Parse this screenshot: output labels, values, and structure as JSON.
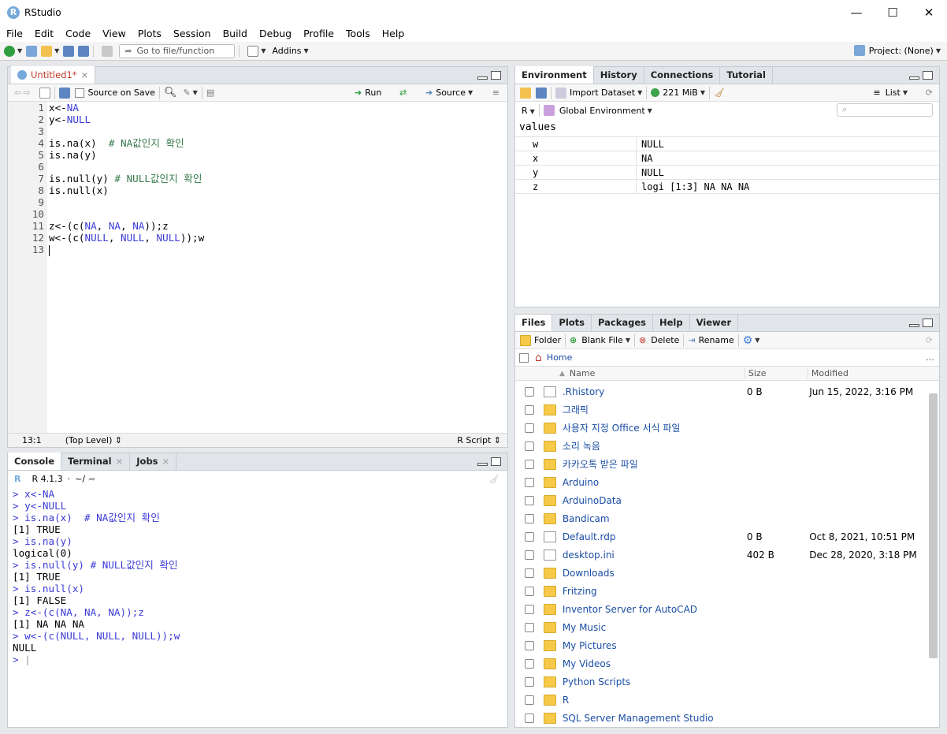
{
  "app": {
    "title": "RStudio",
    "logo": "R"
  },
  "window_controls": {
    "minimize": "—",
    "maximize": "☐",
    "close": "✕"
  },
  "menu": [
    "File",
    "Edit",
    "Code",
    "View",
    "Plots",
    "Session",
    "Build",
    "Debug",
    "Profile",
    "Tools",
    "Help"
  ],
  "toolbar": {
    "goto_placeholder": "Go to file/function",
    "addins": "Addins",
    "project": "Project: (None)"
  },
  "editor": {
    "tab_label": "Untitled1*",
    "source_on_save": "Source on Save",
    "run": "Run",
    "source": "Source",
    "cursor_pos": "13:1",
    "scope": "(Top Level)",
    "file_type": "R Script",
    "lines": [
      {
        "n": "1",
        "parts": [
          [
            "x<-",
            ""
          ],
          [
            "NA",
            "kw"
          ]
        ]
      },
      {
        "n": "2",
        "parts": [
          [
            "y<-",
            ""
          ],
          [
            "NULL",
            "kw"
          ]
        ]
      },
      {
        "n": "3",
        "parts": []
      },
      {
        "n": "4",
        "parts": [
          [
            "is.na(x)  ",
            ""
          ],
          [
            "# NA값인지 확인",
            "cm"
          ]
        ]
      },
      {
        "n": "5",
        "parts": [
          [
            "is.na(y)",
            ""
          ]
        ]
      },
      {
        "n": "6",
        "parts": []
      },
      {
        "n": "7",
        "parts": [
          [
            "is.null(y) ",
            ""
          ],
          [
            "# NULL값인지 확인",
            "cm"
          ]
        ]
      },
      {
        "n": "8",
        "parts": [
          [
            "is.null(x)",
            ""
          ]
        ]
      },
      {
        "n": "9",
        "parts": []
      },
      {
        "n": "10",
        "parts": []
      },
      {
        "n": "11",
        "parts": [
          [
            "z<-(c(",
            ""
          ],
          [
            "NA",
            "kw"
          ],
          [
            ", ",
            ""
          ],
          [
            "NA",
            "kw"
          ],
          [
            ", ",
            ""
          ],
          [
            "NA",
            "kw"
          ],
          [
            "));z",
            ""
          ]
        ]
      },
      {
        "n": "12",
        "parts": [
          [
            "w<-(c(",
            ""
          ],
          [
            "NULL",
            "kw"
          ],
          [
            ", ",
            ""
          ],
          [
            "NULL",
            "kw"
          ],
          [
            ", ",
            ""
          ],
          [
            "NULL",
            "kw"
          ],
          [
            "));w",
            ""
          ]
        ]
      },
      {
        "n": "13",
        "parts": []
      }
    ]
  },
  "console": {
    "tabs": [
      "Console",
      "Terminal",
      "Jobs"
    ],
    "version": "R 4.1.3",
    "path": "~/",
    "lines": [
      {
        "t": "> ",
        "c": "x<-NA",
        "in": true
      },
      {
        "t": "> ",
        "c": "y<-NULL",
        "in": true
      },
      {
        "t": "> ",
        "c": "is.na(x)  # NA값인지 확인",
        "in": true
      },
      {
        "t": "",
        "c": "[1] TRUE",
        "in": false
      },
      {
        "t": "> ",
        "c": "is.na(y)",
        "in": true
      },
      {
        "t": "",
        "c": "logical(0)",
        "in": false
      },
      {
        "t": "> ",
        "c": "is.null(y) # NULL값인지 확인",
        "in": true
      },
      {
        "t": "",
        "c": "[1] TRUE",
        "in": false
      },
      {
        "t": "> ",
        "c": "is.null(x)",
        "in": true
      },
      {
        "t": "",
        "c": "[1] FALSE",
        "in": false
      },
      {
        "t": "> ",
        "c": "z<-(c(NA, NA, NA));z",
        "in": true
      },
      {
        "t": "",
        "c": "[1] NA NA NA",
        "in": false
      },
      {
        "t": "> ",
        "c": "w<-(c(NULL, NULL, NULL));w",
        "in": true
      },
      {
        "t": "",
        "c": "NULL",
        "in": false
      },
      {
        "t": "> ",
        "c": "|",
        "in": true
      }
    ]
  },
  "environment": {
    "tabs": [
      "Environment",
      "History",
      "Connections",
      "Tutorial"
    ],
    "import_dataset": "Import Dataset",
    "memory": "221 MiB",
    "view": "List",
    "lang": "R",
    "scope": "Global Environment",
    "section": "values",
    "rows": [
      {
        "name": "w",
        "value": "NULL"
      },
      {
        "name": "x",
        "value": "NA"
      },
      {
        "name": "y",
        "value": "NULL"
      },
      {
        "name": "z",
        "value": "logi [1:3] NA NA NA"
      }
    ]
  },
  "files": {
    "tabs": [
      "Files",
      "Plots",
      "Packages",
      "Help",
      "Viewer"
    ],
    "folder": "Folder",
    "blank_file": "Blank File",
    "delete": "Delete",
    "rename": "Rename",
    "home": "Home",
    "col_name": "Name",
    "col_size": "Size",
    "col_modified": "Modified",
    "items": [
      {
        "name": ".Rhistory",
        "size": "0 B",
        "modified": "Jun 15, 2022, 3:16 PM",
        "kind": "doc"
      },
      {
        "name": "그래픽",
        "size": "",
        "modified": "",
        "kind": "folder"
      },
      {
        "name": "사용자 지정 Office 서식 파일",
        "size": "",
        "modified": "",
        "kind": "folder"
      },
      {
        "name": "소리 녹음",
        "size": "",
        "modified": "",
        "kind": "folder"
      },
      {
        "name": "카카오톡 받은 파일",
        "size": "",
        "modified": "",
        "kind": "folder"
      },
      {
        "name": "Arduino",
        "size": "",
        "modified": "",
        "kind": "folder"
      },
      {
        "name": "ArduinoData",
        "size": "",
        "modified": "",
        "kind": "folder"
      },
      {
        "name": "Bandicam",
        "size": "",
        "modified": "",
        "kind": "folder"
      },
      {
        "name": "Default.rdp",
        "size": "0 B",
        "modified": "Oct 8, 2021, 10:51 PM",
        "kind": "doc"
      },
      {
        "name": "desktop.ini",
        "size": "402 B",
        "modified": "Dec 28, 2020, 3:18 PM",
        "kind": "doc"
      },
      {
        "name": "Downloads",
        "size": "",
        "modified": "",
        "kind": "folder"
      },
      {
        "name": "Fritzing",
        "size": "",
        "modified": "",
        "kind": "folder"
      },
      {
        "name": "Inventor Server for AutoCAD",
        "size": "",
        "modified": "",
        "kind": "folder"
      },
      {
        "name": "My Music",
        "size": "",
        "modified": "",
        "kind": "folder"
      },
      {
        "name": "My Pictures",
        "size": "",
        "modified": "",
        "kind": "folder"
      },
      {
        "name": "My Videos",
        "size": "",
        "modified": "",
        "kind": "folder"
      },
      {
        "name": "Python Scripts",
        "size": "",
        "modified": "",
        "kind": "folder"
      },
      {
        "name": "R",
        "size": "",
        "modified": "",
        "kind": "folder"
      },
      {
        "name": "SQL Server Management Studio",
        "size": "",
        "modified": "",
        "kind": "folder"
      }
    ]
  }
}
